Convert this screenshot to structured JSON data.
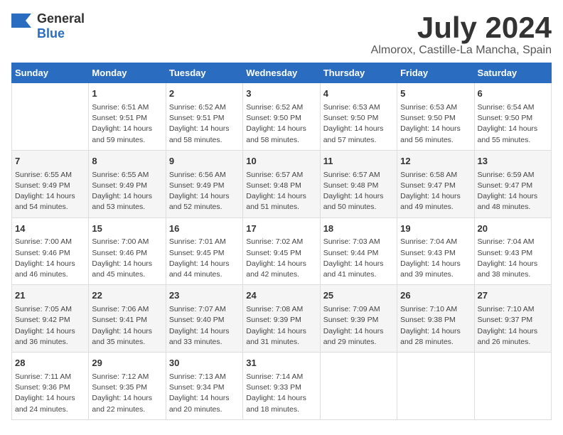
{
  "header": {
    "logo_general": "General",
    "logo_blue": "Blue",
    "title": "July 2024",
    "subtitle": "Almorox, Castille-La Mancha, Spain"
  },
  "calendar": {
    "days_of_week": [
      "Sunday",
      "Monday",
      "Tuesday",
      "Wednesday",
      "Thursday",
      "Friday",
      "Saturday"
    ],
    "weeks": [
      [
        {
          "day": "",
          "info": ""
        },
        {
          "day": "1",
          "info": "Sunrise: 6:51 AM\nSunset: 9:51 PM\nDaylight: 14 hours\nand 59 minutes."
        },
        {
          "day": "2",
          "info": "Sunrise: 6:52 AM\nSunset: 9:51 PM\nDaylight: 14 hours\nand 58 minutes."
        },
        {
          "day": "3",
          "info": "Sunrise: 6:52 AM\nSunset: 9:50 PM\nDaylight: 14 hours\nand 58 minutes."
        },
        {
          "day": "4",
          "info": "Sunrise: 6:53 AM\nSunset: 9:50 PM\nDaylight: 14 hours\nand 57 minutes."
        },
        {
          "day": "5",
          "info": "Sunrise: 6:53 AM\nSunset: 9:50 PM\nDaylight: 14 hours\nand 56 minutes."
        },
        {
          "day": "6",
          "info": "Sunrise: 6:54 AM\nSunset: 9:50 PM\nDaylight: 14 hours\nand 55 minutes."
        }
      ],
      [
        {
          "day": "7",
          "info": "Sunrise: 6:55 AM\nSunset: 9:49 PM\nDaylight: 14 hours\nand 54 minutes."
        },
        {
          "day": "8",
          "info": "Sunrise: 6:55 AM\nSunset: 9:49 PM\nDaylight: 14 hours\nand 53 minutes."
        },
        {
          "day": "9",
          "info": "Sunrise: 6:56 AM\nSunset: 9:49 PM\nDaylight: 14 hours\nand 52 minutes."
        },
        {
          "day": "10",
          "info": "Sunrise: 6:57 AM\nSunset: 9:48 PM\nDaylight: 14 hours\nand 51 minutes."
        },
        {
          "day": "11",
          "info": "Sunrise: 6:57 AM\nSunset: 9:48 PM\nDaylight: 14 hours\nand 50 minutes."
        },
        {
          "day": "12",
          "info": "Sunrise: 6:58 AM\nSunset: 9:47 PM\nDaylight: 14 hours\nand 49 minutes."
        },
        {
          "day": "13",
          "info": "Sunrise: 6:59 AM\nSunset: 9:47 PM\nDaylight: 14 hours\nand 48 minutes."
        }
      ],
      [
        {
          "day": "14",
          "info": "Sunrise: 7:00 AM\nSunset: 9:46 PM\nDaylight: 14 hours\nand 46 minutes."
        },
        {
          "day": "15",
          "info": "Sunrise: 7:00 AM\nSunset: 9:46 PM\nDaylight: 14 hours\nand 45 minutes."
        },
        {
          "day": "16",
          "info": "Sunrise: 7:01 AM\nSunset: 9:45 PM\nDaylight: 14 hours\nand 44 minutes."
        },
        {
          "day": "17",
          "info": "Sunrise: 7:02 AM\nSunset: 9:45 PM\nDaylight: 14 hours\nand 42 minutes."
        },
        {
          "day": "18",
          "info": "Sunrise: 7:03 AM\nSunset: 9:44 PM\nDaylight: 14 hours\nand 41 minutes."
        },
        {
          "day": "19",
          "info": "Sunrise: 7:04 AM\nSunset: 9:43 PM\nDaylight: 14 hours\nand 39 minutes."
        },
        {
          "day": "20",
          "info": "Sunrise: 7:04 AM\nSunset: 9:43 PM\nDaylight: 14 hours\nand 38 minutes."
        }
      ],
      [
        {
          "day": "21",
          "info": "Sunrise: 7:05 AM\nSunset: 9:42 PM\nDaylight: 14 hours\nand 36 minutes."
        },
        {
          "day": "22",
          "info": "Sunrise: 7:06 AM\nSunset: 9:41 PM\nDaylight: 14 hours\nand 35 minutes."
        },
        {
          "day": "23",
          "info": "Sunrise: 7:07 AM\nSunset: 9:40 PM\nDaylight: 14 hours\nand 33 minutes."
        },
        {
          "day": "24",
          "info": "Sunrise: 7:08 AM\nSunset: 9:39 PM\nDaylight: 14 hours\nand 31 minutes."
        },
        {
          "day": "25",
          "info": "Sunrise: 7:09 AM\nSunset: 9:39 PM\nDaylight: 14 hours\nand 29 minutes."
        },
        {
          "day": "26",
          "info": "Sunrise: 7:10 AM\nSunset: 9:38 PM\nDaylight: 14 hours\nand 28 minutes."
        },
        {
          "day": "27",
          "info": "Sunrise: 7:10 AM\nSunset: 9:37 PM\nDaylight: 14 hours\nand 26 minutes."
        }
      ],
      [
        {
          "day": "28",
          "info": "Sunrise: 7:11 AM\nSunset: 9:36 PM\nDaylight: 14 hours\nand 24 minutes."
        },
        {
          "day": "29",
          "info": "Sunrise: 7:12 AM\nSunset: 9:35 PM\nDaylight: 14 hours\nand 22 minutes."
        },
        {
          "day": "30",
          "info": "Sunrise: 7:13 AM\nSunset: 9:34 PM\nDaylight: 14 hours\nand 20 minutes."
        },
        {
          "day": "31",
          "info": "Sunrise: 7:14 AM\nSunset: 9:33 PM\nDaylight: 14 hours\nand 18 minutes."
        },
        {
          "day": "",
          "info": ""
        },
        {
          "day": "",
          "info": ""
        },
        {
          "day": "",
          "info": ""
        }
      ]
    ]
  }
}
